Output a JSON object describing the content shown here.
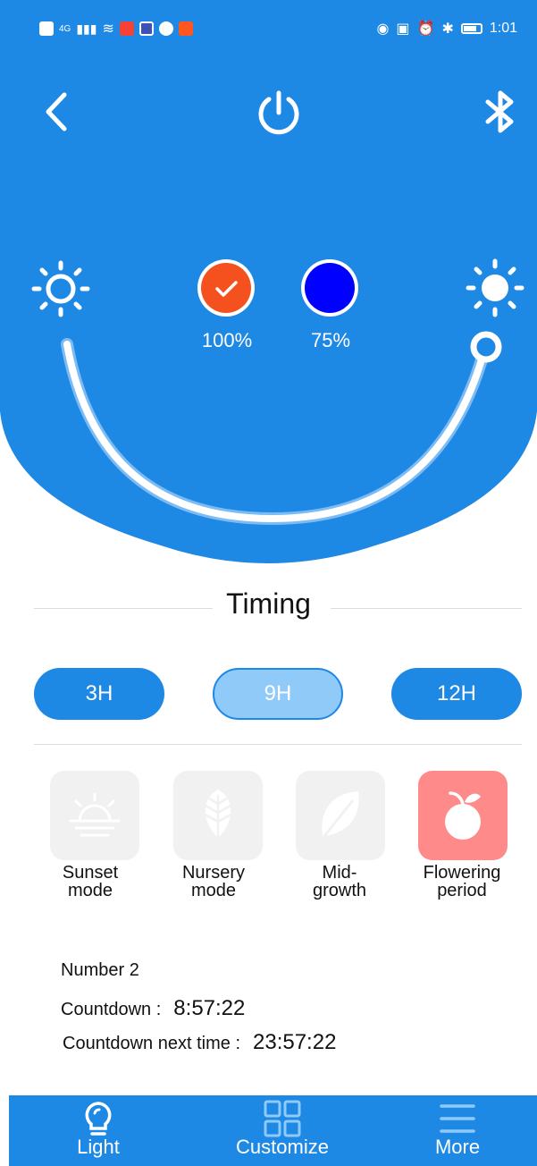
{
  "status_bar": {
    "network": "4G",
    "time": "1:01"
  },
  "header": {
    "back_icon": "chevron-left-icon",
    "power_icon": "power-icon",
    "bluetooth_icon": "bluetooth-icon"
  },
  "channels": [
    {
      "color": "#f4511e",
      "percent": "100%",
      "selected": true
    },
    {
      "color": "#0000ff",
      "percent": "75%",
      "selected": false
    }
  ],
  "slider": {
    "value": 1.0
  },
  "timing": {
    "title": "Timing",
    "options": [
      {
        "label": "3H",
        "selected": false
      },
      {
        "label": "9H",
        "selected": true
      },
      {
        "label": "12H",
        "selected": false
      }
    ]
  },
  "modes": [
    {
      "line1": "Sunset",
      "line2": "mode",
      "icon": "sunset-icon",
      "active": false
    },
    {
      "line1": "Nursery",
      "line2": "mode",
      "icon": "leaf-fern-icon",
      "active": false
    },
    {
      "line1": "Mid-",
      "line2": "growth",
      "icon": "leaf-icon",
      "active": false
    },
    {
      "line1": "Flowering",
      "line2": "period",
      "icon": "fruit-icon",
      "active": true
    }
  ],
  "info": {
    "number_label": "Number 2",
    "countdown_label": "Countdown :",
    "countdown_value": "8:57:22",
    "next_label": "Countdown next time :",
    "next_value": "23:57:22"
  },
  "nav": {
    "light": "Light",
    "customize": "Customize",
    "more": "More"
  },
  "colors": {
    "primary": "#1e88e5",
    "active_mode": "#ff8a8a"
  }
}
